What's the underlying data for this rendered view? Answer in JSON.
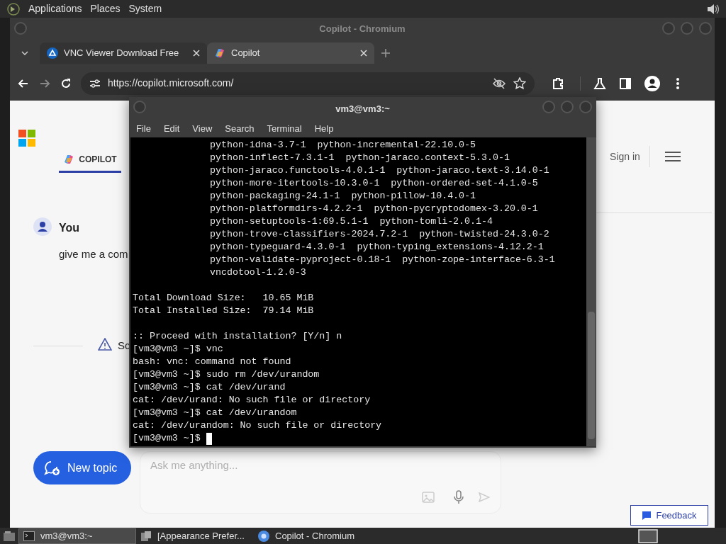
{
  "top_panel": {
    "menus": [
      "Applications",
      "Places",
      "System"
    ]
  },
  "browser": {
    "title": "Copilot - Chromium",
    "tabs": [
      {
        "label": "VNC Viewer Download Free",
        "selected": false
      },
      {
        "label": "Copilot",
        "selected": true
      }
    ],
    "url": "https://copilot.microsoft.com/",
    "page": {
      "nav_tab": "COPILOT",
      "sign_in": "Sign in",
      "author": "You",
      "message": "give me a com",
      "notice": "Sc",
      "new_topic": "New topic",
      "input": {
        "placeholder": "Ask me anything..."
      },
      "feedback": "Feedback"
    }
  },
  "terminal": {
    "title": "vm3@vm3:~",
    "menus": [
      "File",
      "Edit",
      "View",
      "Search",
      "Terminal",
      "Help"
    ],
    "lines": [
      {
        "kind": "package",
        "text": "python-idna-3.7-1  python-incremental-22.10.0-5"
      },
      {
        "kind": "package",
        "text": "python-inflect-7.3.1-1  python-jaraco.context-5.3.0-1"
      },
      {
        "kind": "package",
        "text": "python-jaraco.functools-4.0.1-1  python-jaraco.text-3.14.0-1"
      },
      {
        "kind": "package",
        "text": "python-more-itertools-10.3.0-1  python-ordered-set-4.1.0-5"
      },
      {
        "kind": "package",
        "text": "python-packaging-24.1-1  python-pillow-10.4.0-1"
      },
      {
        "kind": "package",
        "text": "python-platformdirs-4.2.2-1  python-pycryptodomex-3.20.0-1"
      },
      {
        "kind": "package",
        "text": "python-setuptools-1:69.5.1-1  python-tomli-2.0.1-4"
      },
      {
        "kind": "package",
        "text": "python-trove-classifiers-2024.7.2-1  python-twisted-24.3.0-2"
      },
      {
        "kind": "package",
        "text": "python-typeguard-4.3.0-1  python-typing_extensions-4.12.2-1"
      },
      {
        "kind": "package",
        "text": "python-validate-pyproject-0.18-1  python-zope-interface-6.3-1"
      },
      {
        "kind": "package",
        "text": "vncdotool-1.2.0-3"
      },
      {
        "kind": "blank"
      },
      {
        "kind": "output",
        "text": "Total Download Size:   10.65 MiB"
      },
      {
        "kind": "output",
        "text": "Total Installed Size:  79.14 MiB"
      },
      {
        "kind": "blank"
      },
      {
        "kind": "output",
        "text": ":: Proceed with installation? [Y/n] n"
      },
      {
        "kind": "output",
        "text": "[vm3@vm3 ~]$ vnc"
      },
      {
        "kind": "output",
        "text": "bash: vnc: command not found"
      },
      {
        "kind": "output",
        "text": "[vm3@vm3 ~]$ sudo rm /dev/urandom"
      },
      {
        "kind": "output",
        "text": "[vm3@vm3 ~]$ cat /dev/urand"
      },
      {
        "kind": "output",
        "text": "cat: /dev/urand: No such file or directory"
      },
      {
        "kind": "output",
        "text": "[vm3@vm3 ~]$ cat /dev/urandom"
      },
      {
        "kind": "output",
        "text": "cat: /dev/urandom: No such file or directory"
      },
      {
        "kind": "prompt",
        "text": "[vm3@vm3 ~]$",
        "cursor": true
      }
    ]
  },
  "taskbar": {
    "items": [
      {
        "label": "vm3@vm3:~",
        "kind": "terminal",
        "selected": true
      },
      {
        "label": "[Appearance Prefer...",
        "kind": "settings",
        "selected": false
      },
      {
        "label": "Copilot - Chromium",
        "kind": "chromium",
        "selected": false
      }
    ]
  }
}
